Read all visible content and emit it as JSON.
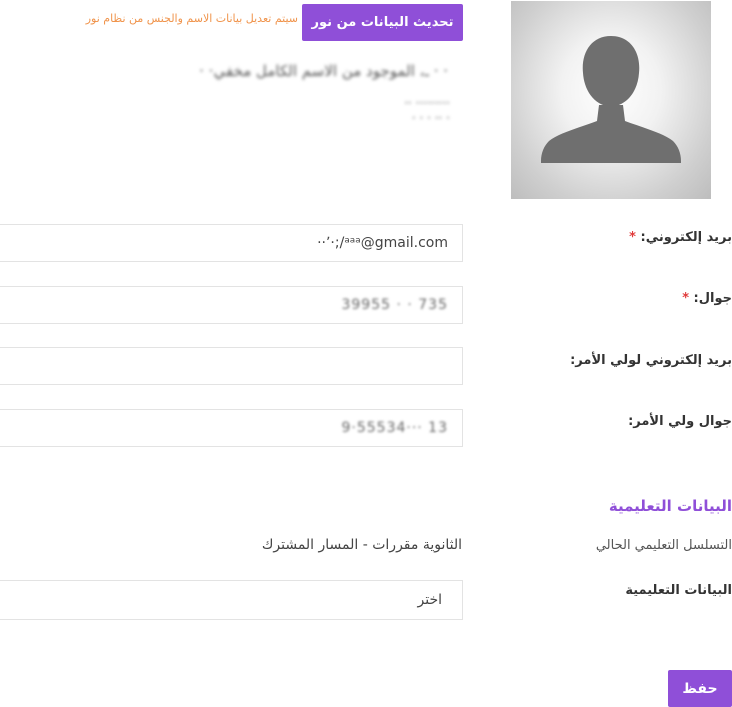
{
  "profile": {
    "photo_icon": "user-silhouette-icon",
    "noor_button": "تحديث البيانات من نور",
    "noor_note": "سيتم تعديل بيانات الاسم والجنس من نظام نور",
    "name_line_1": "· ·ـ، الموجود من الاسم الكامل مخفي · ·",
    "name_line_2": "·· ·········",
    "name_line_3": "· · · ·· ·"
  },
  "form": {
    "email_label": "بريد إلكتروني:",
    "email_value": "··ʼ·;/ᵃᵃᵃ@gmail.com",
    "mobile_label": "جوال:",
    "mobile_value": "39955 · · 735",
    "guardian_email_label": "بريد إلكتروني لولي الأمر:",
    "guardian_email_value": "",
    "guardian_mobile_label": "جوال ولي الأمر:",
    "guardian_mobile_value": "9·55534··· 13",
    "required_mark": "*"
  },
  "education": {
    "section_title": "البيانات التعليمية",
    "current_sequence_label": "التسلسل التعليمي الحالي",
    "current_sequence_value": "الثانوية مقررات - المسار المشترك",
    "data_label": "البيانات التعليمية",
    "select_value": "اختر"
  },
  "actions": {
    "save_label": "حفظ"
  },
  "colors": {
    "accent": "#8f4fd8",
    "note": "#f0944c",
    "required": "#e03b3b"
  }
}
